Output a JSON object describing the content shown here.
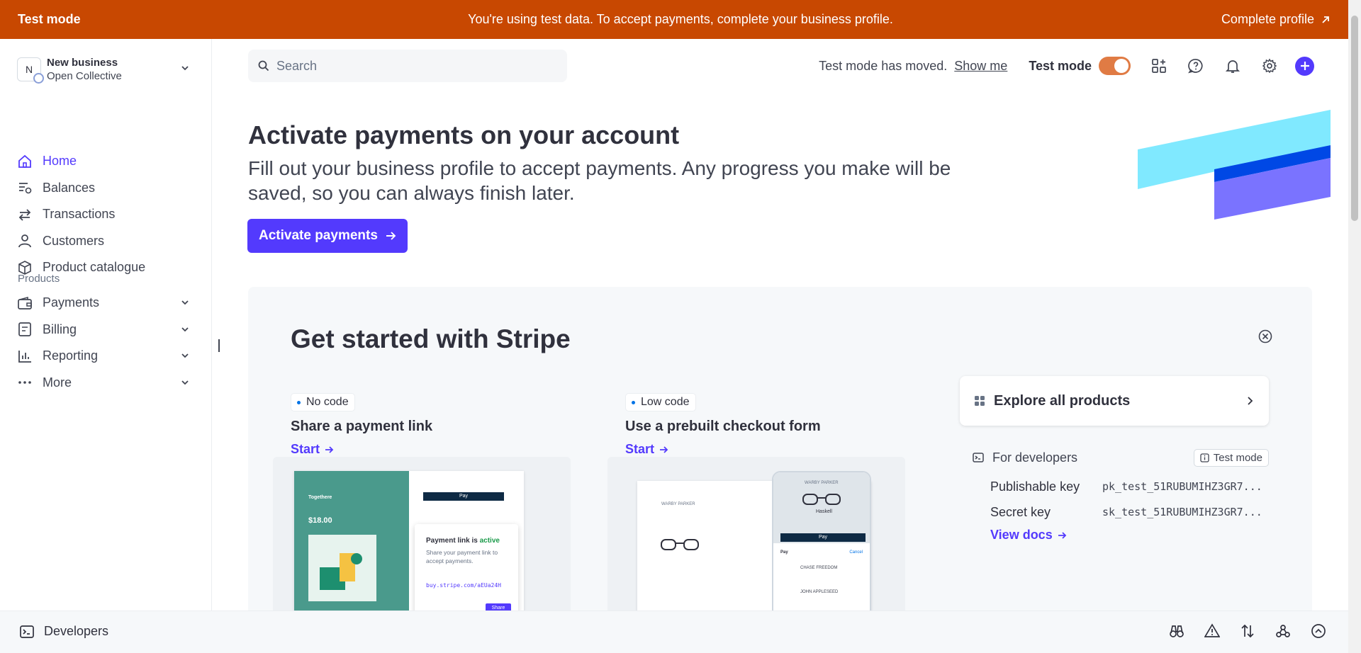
{
  "banner": {
    "label": "Test mode",
    "message": "You're using test data. To accept payments, complete your business profile.",
    "action": "Complete profile"
  },
  "account": {
    "initial": "N",
    "name": "New business",
    "subtitle": "Open Collective"
  },
  "nav": {
    "items": [
      {
        "label": "Home",
        "icon": "home-icon"
      },
      {
        "label": "Balances",
        "icon": "balances-icon"
      },
      {
        "label": "Transactions",
        "icon": "transactions-icon"
      },
      {
        "label": "Customers",
        "icon": "customers-icon"
      },
      {
        "label": "Product catalogue",
        "icon": "product-catalogue-icon"
      }
    ],
    "products_heading": "Products",
    "product_items": [
      {
        "label": "Payments",
        "icon": "wallet-icon"
      },
      {
        "label": "Billing",
        "icon": "billing-icon"
      },
      {
        "label": "Reporting",
        "icon": "bar-chart-icon"
      },
      {
        "label": "More",
        "icon": "more-dots-icon"
      }
    ]
  },
  "topbar": {
    "search_placeholder": "Search",
    "moved_text": "Test mode has moved.",
    "show_me": "Show me",
    "test_mode_label": "Test mode",
    "test_mode_on": true
  },
  "hero": {
    "title": "Activate payments on your account",
    "subtitle": "Fill out your business profile to accept payments. Any progress you make will be saved, so you can always finish later.",
    "button": "Activate payments"
  },
  "get_started": {
    "title": "Get started with Stripe",
    "cards": [
      {
        "badge": "No code",
        "title": "Share a payment link",
        "link": "Start",
        "preview": {
          "brand": "Togethere",
          "price": "$18.00",
          "pay": "Pay",
          "popup_title_prefix": "Payment link is ",
          "popup_status": "active",
          "popup_desc": "Share your payment link to accept payments.",
          "url": "buy.stripe.com/aEUa24H",
          "share": "Share"
        }
      },
      {
        "badge": "Low code",
        "title": "Use a prebuilt checkout form",
        "link": "Start",
        "preview": {
          "brand": "WARBY PARKER",
          "product": "Haskell",
          "pay": "Pay",
          "cancel": "Cancel",
          "card_line": "CHASE FREEDOM",
          "addr_name": "JOHN APPLESEED"
        }
      }
    ],
    "explore": "Explore all products",
    "developers": {
      "title": "For developers",
      "chip": "Test mode",
      "keys": [
        {
          "label": "Publishable key",
          "value": "pk_test_51RUBUMIHZ3GR7..."
        },
        {
          "label": "Secret key",
          "value": "sk_test_51RUBUMIHZ3GR7..."
        }
      ],
      "docs": "View docs"
    }
  },
  "bottombar": {
    "developers": "Developers"
  },
  "colors": {
    "banner": "#c84801",
    "accent": "#533afd",
    "toggle": "#e07b44",
    "deco_cyan": "#80e9ff",
    "deco_blue": "#0048e5",
    "deco_violet": "#7a73ff"
  }
}
